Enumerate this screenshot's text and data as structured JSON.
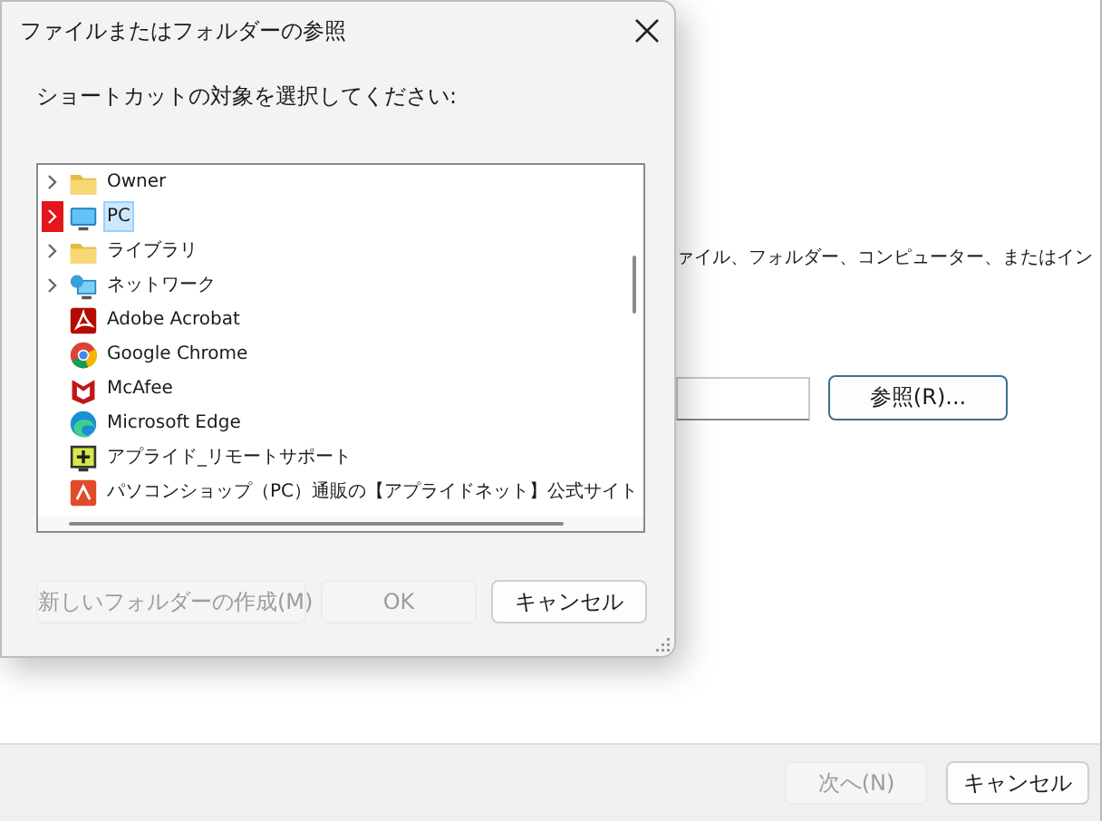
{
  "background_window": {
    "description": "ァイル、フォルダー、コンピューター、またはイン",
    "browse_button": "参照(R)...",
    "footer_buttons": [
      {
        "label": "次へ(N)",
        "disabled": true
      },
      {
        "label": "キャンセル",
        "disabled": false
      }
    ]
  },
  "dialog": {
    "title": "ファイルまたはフォルダーの参照",
    "prompt": "ショートカットの対象を選択してください:",
    "tree": [
      {
        "label": "Owner",
        "kind": "folder",
        "expandable": true,
        "selected": false,
        "highlighted": false
      },
      {
        "label": "PC",
        "kind": "pc",
        "expandable": true,
        "selected": true,
        "highlighted": true
      },
      {
        "label": "ライブラリ",
        "kind": "folder",
        "expandable": true,
        "selected": false,
        "highlighted": false
      },
      {
        "label": "ネットワーク",
        "kind": "network",
        "expandable": true,
        "selected": false,
        "highlighted": false
      },
      {
        "label": "Adobe Acrobat",
        "kind": "acrobat",
        "expandable": false,
        "selected": false,
        "highlighted": false
      },
      {
        "label": "Google Chrome",
        "kind": "chrome",
        "expandable": false,
        "selected": false,
        "highlighted": false
      },
      {
        "label": "McAfee",
        "kind": "mcafee",
        "expandable": false,
        "selected": false,
        "highlighted": false
      },
      {
        "label": "Microsoft Edge",
        "kind": "edge",
        "expandable": false,
        "selected": false,
        "highlighted": false
      },
      {
        "label": "アプライド_リモートサポート",
        "kind": "remote",
        "expandable": false,
        "selected": false,
        "highlighted": false
      },
      {
        "label": "パソコンショップ（PC）通販の【アプライドネット】公式サイト",
        "kind": "web",
        "expandable": false,
        "selected": false,
        "highlighted": false
      }
    ],
    "buttons": [
      {
        "label": "新しいフォルダーの作成(M)",
        "disabled": true
      },
      {
        "label": "OK",
        "disabled": true
      },
      {
        "label": "キャンセル",
        "disabled": false
      }
    ]
  }
}
